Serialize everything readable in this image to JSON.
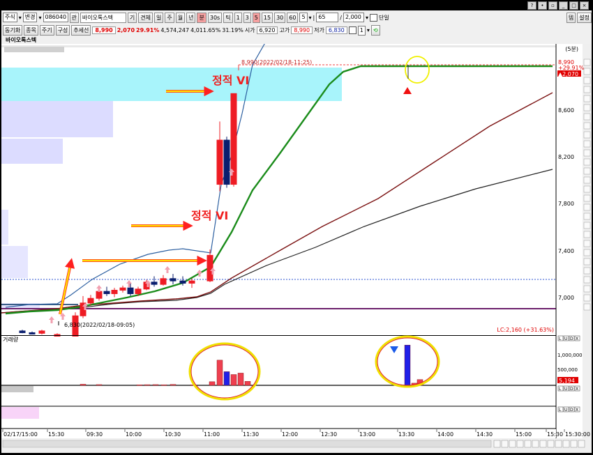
{
  "toolbar": {
    "type_select": "주식",
    "change_select": "변경",
    "code": "086040",
    "search_btn": "관",
    "name_tag": "바이오톡스텍",
    "periods": [
      "기",
      "견체",
      "일",
      "주",
      "월",
      "년",
      "분",
      "30s",
      "틱"
    ],
    "minutes": [
      "1",
      "3",
      "5",
      "15",
      "30",
      "60"
    ],
    "minute_value": "5",
    "count_value": "65",
    "total_value": "2,000",
    "single_chk": "단일",
    "right_btn1": "템",
    "right_btn2": "설정"
  },
  "toolbar2": {
    "items": [
      "동기화",
      "종목",
      "주기",
      "구성",
      "추세선"
    ],
    "price": "8,990",
    "change": "2,070",
    "change_pct": "29.91%",
    "volume": "4,574,247",
    "volume2": "4,011.65%",
    "rate": "31.19%",
    "open_label": "시가",
    "open_value": "6,920",
    "high_label": "고가",
    "high_value": "8,990",
    "low_label": "저가",
    "low_value": "6,830",
    "stepper": "1"
  },
  "tab_label": "바이오톡스텍",
  "chart": {
    "unit_label": "(5분)",
    "price_labels": [
      "8,600",
      "8,200",
      "7,800",
      "7,400",
      "7,000"
    ],
    "current_price": "8,990",
    "current_pct": "+29.91%",
    "current_change": "▲2,070",
    "high_annotation": "8,990(2022/02/18-11:25)",
    "low_annotation": "6,830(2022/02/18-09:05)",
    "lc_text": "LC:2,160 (+31.63%)",
    "vi_label_1": "정적 VI",
    "vi_label_2": "정적 VI",
    "vol_title": "거래량",
    "vol_ticks": [
      "1,000,000",
      "500,000"
    ],
    "vol_current": "5,194",
    "time_labels": [
      "02/17/15:00",
      "15:30",
      "09:30",
      "10:00",
      "10:30",
      "11:00",
      "11:30",
      "12:00",
      "12:30",
      "13:00",
      "13:30",
      "14:00",
      "14:30",
      "15:00",
      "15:30",
      "15:30:00"
    ],
    "panel_btns": [
      "L",
      "U",
      "D",
      "X"
    ]
  },
  "chart_data": {
    "type": "candlestick",
    "price_range": [
      6830,
      8990
    ],
    "candles": [
      {
        "o": 6950,
        "h": 6960,
        "l": 6930,
        "c": 6935,
        "dir": "down"
      },
      {
        "o": 6935,
        "h": 6945,
        "l": 6920,
        "c": 6925,
        "dir": "down"
      },
      {
        "o": 6930,
        "h": 6960,
        "l": 6920,
        "c": 6950,
        "dir": "up"
      },
      {
        "o": 6920,
        "h": 6930,
        "l": 6830,
        "c": 6900,
        "dir": "up"
      },
      {
        "o": 6900,
        "h": 7110,
        "l": 6880,
        "c": 7080,
        "dir": "up"
      },
      {
        "o": 7080,
        "h": 7250,
        "l": 7060,
        "c": 7190,
        "dir": "up"
      },
      {
        "o": 7190,
        "h": 7260,
        "l": 7170,
        "c": 7230,
        "dir": "up"
      },
      {
        "o": 7230,
        "h": 7340,
        "l": 7210,
        "c": 7290,
        "dir": "up"
      },
      {
        "o": 7290,
        "h": 7330,
        "l": 7250,
        "c": 7270,
        "dir": "down"
      },
      {
        "o": 7270,
        "h": 7320,
        "l": 7240,
        "c": 7300,
        "dir": "up"
      },
      {
        "o": 7300,
        "h": 7340,
        "l": 7280,
        "c": 7320,
        "dir": "up"
      },
      {
        "o": 7320,
        "h": 7360,
        "l": 7250,
        "c": 7270,
        "dir": "down"
      },
      {
        "o": 7270,
        "h": 7330,
        "l": 7250,
        "c": 7310,
        "dir": "up"
      },
      {
        "o": 7310,
        "h": 7390,
        "l": 7300,
        "c": 7370,
        "dir": "up"
      },
      {
        "o": 7370,
        "h": 7420,
        "l": 7330,
        "c": 7350,
        "dir": "down"
      },
      {
        "o": 7350,
        "h": 7430,
        "l": 7340,
        "c": 7400,
        "dir": "up"
      },
      {
        "o": 7400,
        "h": 7440,
        "l": 7350,
        "c": 7380,
        "dir": "down"
      },
      {
        "o": 7380,
        "h": 7420,
        "l": 7340,
        "c": 7360,
        "dir": "down"
      },
      {
        "o": 7360,
        "h": 7400,
        "l": 7320,
        "c": 7380,
        "dir": "up"
      },
      {
        "o": 7380,
        "h": 7650,
        "l": 7370,
        "c": 7600,
        "dir": "up"
      },
      {
        "o": 8210,
        "h": 8750,
        "l": 8150,
        "c": 8590,
        "dir": "up"
      },
      {
        "o": 8590,
        "h": 8620,
        "l": 8180,
        "c": 8210,
        "dir": "down"
      },
      {
        "o": 8210,
        "h": 8990,
        "l": 8190,
        "c": 8990,
        "dir": "up"
      }
    ],
    "volume": [
      {
        "v": 30000,
        "dir": "up"
      },
      {
        "v": 20000,
        "dir": "up"
      },
      {
        "v": 15000,
        "dir": "up"
      },
      {
        "v": 18000,
        "dir": "up"
      },
      {
        "v": 20000,
        "dir": "up"
      },
      {
        "v": 16000,
        "dir": "up"
      },
      {
        "v": 25000,
        "dir": "up"
      },
      {
        "v": 15000,
        "dir": "up"
      },
      {
        "v": 100000,
        "dir": "up"
      },
      {
        "v": 700000,
        "dir": "up"
      },
      {
        "v": 380000,
        "dir": "down"
      },
      {
        "v": 300000,
        "dir": "up"
      },
      {
        "v": 340000,
        "dir": "up"
      },
      {
        "v": 110000,
        "dir": "up"
      },
      {
        "v": 1120000,
        "dir": "down"
      },
      {
        "v": 60000,
        "dir": "up"
      },
      {
        "v": 160000,
        "dir": "up"
      }
    ]
  }
}
